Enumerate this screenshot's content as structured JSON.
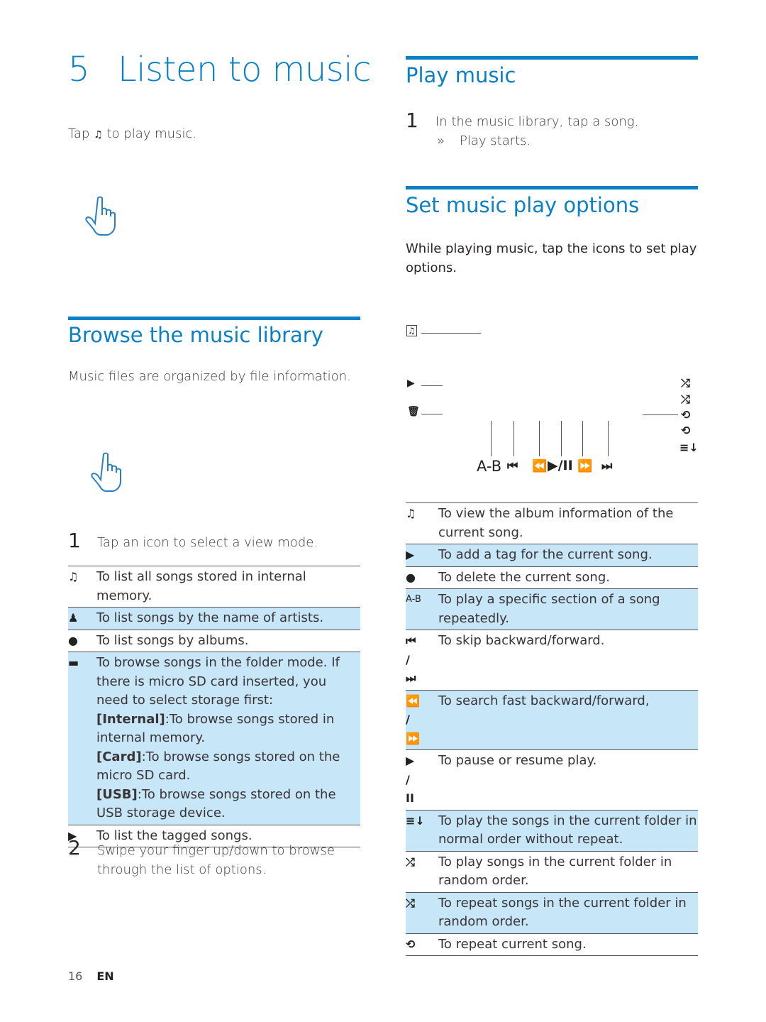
{
  "chapter": {
    "number": "5",
    "title": "Listen to music"
  },
  "intro": {
    "before": "Tap",
    "icon": "music-app-icon",
    "glyph": "♫",
    "after": "to play music."
  },
  "browse": {
    "heading": "Browse the music library",
    "description": "Music files are organized by file information.",
    "step1": {
      "num": "1",
      "text": "Tap an icon to select a view mode."
    },
    "options": [
      {
        "icon": "music-note-icon",
        "glyph": "♫",
        "text": "To list all songs stored in internal memory.",
        "highlight": false
      },
      {
        "icon": "artist-icon",
        "glyph": "♟",
        "text": "To list songs by the name of artists.",
        "highlight": true
      },
      {
        "icon": "album-icon",
        "glyph": "●",
        "text": "To list songs by albums.",
        "highlight": false
      },
      {
        "icon": "folder-icon",
        "glyph": "▬",
        "text": "To browse songs in the folder mode. If there is micro SD card inserted, you need to select storage first:",
        "highlight": true,
        "sub": [
          {
            "label": "[Internal]",
            "text": ":To browse songs stored in internal memory."
          },
          {
            "label": "[Card]",
            "text": ":To browse songs stored on the micro SD card."
          },
          {
            "label": "[USB]",
            "text": ":To browse songs stored on the USB storage device."
          }
        ]
      },
      {
        "icon": "tagged-songs-icon",
        "glyph": "▶",
        "text": "To list the tagged songs.",
        "highlight": false
      }
    ],
    "step2": {
      "num": "2",
      "text": "Swipe your finger up/down to browse through the list of options."
    }
  },
  "play": {
    "heading": "Play music",
    "step1": {
      "num": "1",
      "text": "In the music library, tap a song."
    },
    "result": {
      "marker": "»",
      "text": "Play starts."
    }
  },
  "options_section": {
    "heading": "Set music play options",
    "description": "While playing music, tap the icons to set play options.",
    "diagram": {
      "controls": {
        "ab": "A-B",
        "prev": "⏮",
        "rew": "⏪",
        "playpause": "▶/II",
        "ff": "⏩",
        "next": "⏭"
      },
      "left_icons": [
        "♫",
        "▶",
        "🗑"
      ],
      "right_icons": [
        "⤮",
        "⤮",
        "⟲",
        "⟲",
        "≡↓"
      ]
    },
    "table": [
      {
        "icon": "album-info-icon",
        "glyph": "♫",
        "text": "To view the album information of the current song.",
        "highlight": false
      },
      {
        "icon": "add-tag-icon",
        "glyph": "▶",
        "text": "To add a tag for the current song.",
        "highlight": true
      },
      {
        "icon": "delete-icon",
        "glyph": "●",
        "text": "To delete the current song.",
        "highlight": false
      },
      {
        "icon": "ab-repeat-icon",
        "glyph": "A-B",
        "text": "To play a specific section of a song repeatedly.",
        "highlight": true
      },
      {
        "icon": "skip-icon",
        "glyph": "⏮\n/\n⏭",
        "text": "To skip backward/forward.",
        "highlight": false
      },
      {
        "icon": "search-fast-icon",
        "glyph": "⏪\n/\n⏩",
        "text": "To search fast backward/forward,",
        "highlight": true
      },
      {
        "icon": "play-pause-icon",
        "glyph": "▶\n/\nII",
        "text": "To pause or resume play.",
        "highlight": false
      },
      {
        "icon": "normal-order-icon",
        "glyph": "≡↓",
        "text": "To play the songs in the current folder in normal order without repeat.",
        "highlight": true
      },
      {
        "icon": "shuffle-icon",
        "glyph": "⤮",
        "text": "To play songs in the current folder in random order.",
        "highlight": false
      },
      {
        "icon": "shuffle-repeat-icon",
        "glyph": "⤮",
        "text": "To repeat songs in the current folder in random order.",
        "highlight": true
      },
      {
        "icon": "repeat-one-icon",
        "glyph": "⟲",
        "text": "To repeat current song.",
        "highlight": false
      }
    ]
  },
  "footer": {
    "page": "16",
    "lang": "EN"
  }
}
